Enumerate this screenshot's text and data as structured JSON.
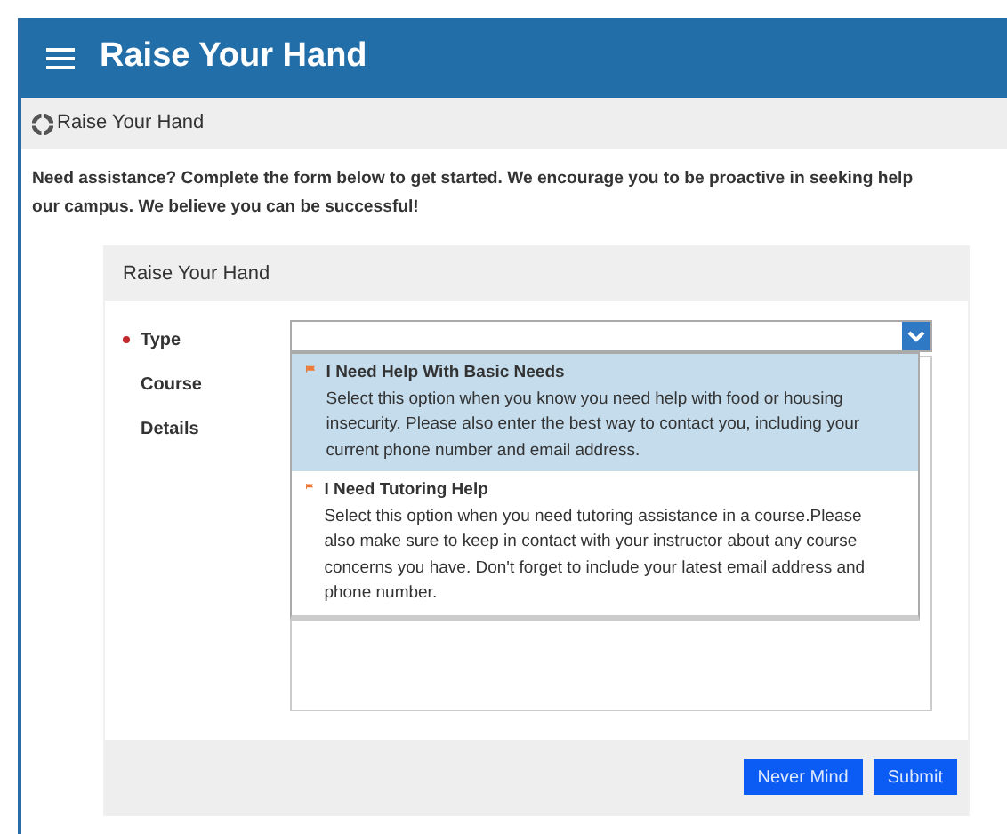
{
  "header": {
    "title": "Raise Your Hand"
  },
  "breadcrumb": {
    "label": "Raise Your Hand"
  },
  "intro": [
    "Need assistance? Complete the form below to get started. We encourage you to be proactive in seeking help",
    "our campus. We believe you can be successful!"
  ],
  "form": {
    "title": "Raise Your Hand",
    "fields": [
      {
        "label": "Type",
        "required": true,
        "kind": "select"
      },
      {
        "label": "Course",
        "required": false,
        "kind": "hidden"
      },
      {
        "label": "Details",
        "required": false,
        "kind": "textarea"
      }
    ],
    "dropdown": {
      "expanded": true,
      "options": [
        {
          "title": "I Need Help With Basic Needs",
          "description": "Select this option when you know you need help with food or housing insecurity. Please also enter the best way to contact you, including your current phone number and email address.",
          "selected": true
        },
        {
          "title": "I Need Tutoring Help",
          "description": "Select this option when you need tutoring assistance in a course.Please also make sure to keep in contact with your instructor about any course concerns you have. Don't forget to include your latest email address and phone number.",
          "selected": false
        }
      ]
    },
    "buttons": [
      "Never Mind",
      "Submit"
    ]
  }
}
